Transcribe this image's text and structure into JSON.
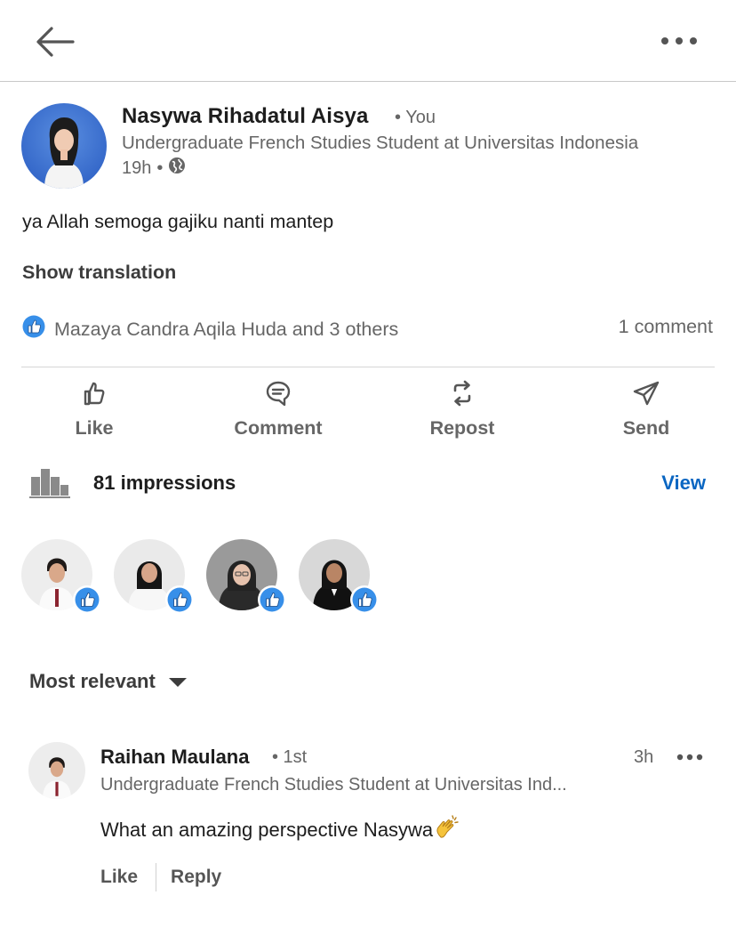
{
  "post": {
    "author_name": "Nasywa Rihadatul Aisya",
    "author_relation": "• You",
    "author_headline": "Undergraduate French Studies Student at Universitas Indonesia",
    "time": "19h",
    "visibility_sep": "•",
    "visibility_icon": "globe-icon",
    "body": "ya Allah semoga gajiku nanti mantep",
    "show_translation": "Show translation",
    "reactions_summary": "Mazaya Candra Aqila Huda and 3 others",
    "reaction_icon": "like-reaction-icon",
    "comment_count": "1 comment"
  },
  "actions": [
    {
      "label": "Like",
      "icon": "thumbs-up-icon"
    },
    {
      "label": "Comment",
      "icon": "comment-icon"
    },
    {
      "label": "Repost",
      "icon": "repost-icon"
    },
    {
      "label": "Send",
      "icon": "send-icon"
    }
  ],
  "impressions": {
    "text": "81 impressions",
    "view_label": "View",
    "icon": "bar-chart-icon"
  },
  "reactors_count": 4,
  "sort": {
    "label": "Most relevant",
    "icon": "caret-down-icon"
  },
  "comment": {
    "name": "Raihan Maulana",
    "degree": "• 1st",
    "time": "3h",
    "headline": "Undergraduate French Studies Student at Universitas Ind...",
    "text": "What an amazing perspective Nasywa",
    "emoji": "clapping-hands-emoji",
    "like_label": "Like",
    "reply_label": "Reply"
  },
  "colors": {
    "accent_blue": "#0a66c2",
    "like_badge_blue": "#378fe9",
    "muted_text": "#666666"
  }
}
